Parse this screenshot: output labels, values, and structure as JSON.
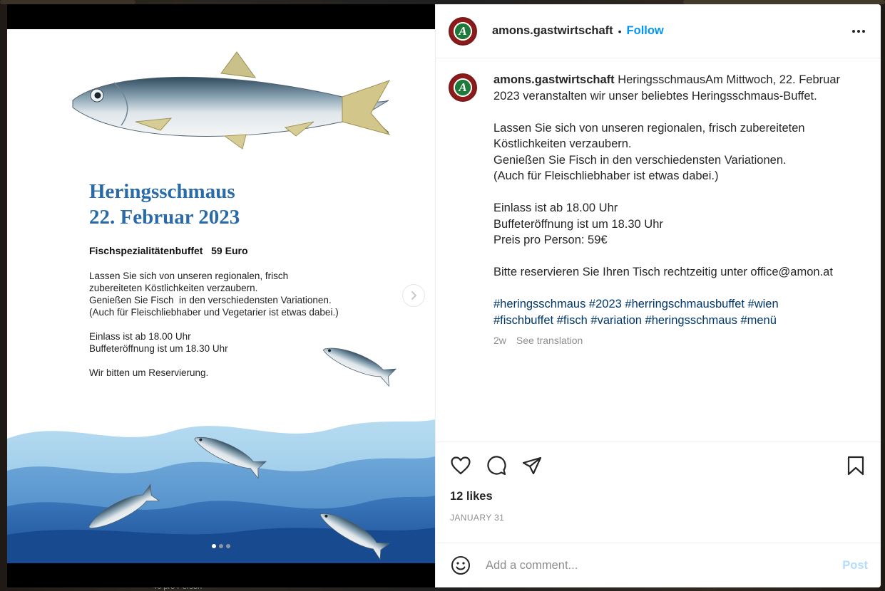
{
  "background": {
    "partial_text": "46 pro Person"
  },
  "post": {
    "username": "amons.gastwirtschaft",
    "separator": "•",
    "follow_label": "Follow",
    "avatar_letter": "A",
    "more_icon": "more-horizontal-icon"
  },
  "flyer": {
    "title_line1": "Heringsschmaus",
    "title_line2": "22. Februar 2023",
    "buffet_line": "Fischspezialitätenbuffet   59 Euro",
    "body": [
      "Lassen Sie sich von unseren regionalen, frisch",
      "zubereiteten Köstlichkeiten verzaubern.",
      "Genießen Sie Fisch  in den verschiedensten Variationen.",
      "(Auch für Fleischliebhaber und Vegetarier ist etwas dabei.)",
      "",
      "Einlass ist ab 18.00 Uhr",
      "Buffeteröffnung ist um 18.30 Uhr",
      "",
      "Wir bitten um Reservierung."
    ],
    "colors": {
      "title": "#2a6aa8",
      "wave_light": "#a9d2ec",
      "wave_dark": "#1f5fa6"
    }
  },
  "carousel": {
    "slide_count": 3,
    "active_index": 0,
    "next_icon": "chevron-right-icon"
  },
  "caption": {
    "username": "amons.gastwirtschaft",
    "lines": [
      "HeringsschmausAm Mittwoch, 22. Februar",
      "2023 veranstalten wir unser beliebtes Heringsschmaus-Buffet.",
      "",
      "Lassen Sie sich von unseren regionalen, frisch zubereiteten",
      "Köstlichkeiten verzaubern.",
      "Genießen Sie Fisch in den verschiedensten Variationen.",
      "(Auch für Fleischliebhaber ist etwas dabei.)",
      "",
      "Einlass ist ab 18.00 Uhr",
      "Buffeteröffnung ist um 18.30 Uhr",
      "Preis pro Person: 59€",
      "",
      "Bitte reservieren Sie Ihren Tisch rechtzeitig unter office@amon.at",
      ""
    ],
    "hashtags_line1": [
      "#heringsschmaus",
      "#2023",
      "#herringschmausbuffet",
      "#wien"
    ],
    "hashtags_line2": [
      "#fischbuffet",
      "#fisch",
      "#variation",
      "#heringsschmaus",
      "#menü"
    ],
    "age": "2w",
    "translate_label": "See translation"
  },
  "actions": {
    "icons": [
      "heart-icon",
      "comment-icon",
      "share-icon",
      "bookmark-icon"
    ],
    "likes": "12 likes",
    "date": "JANUARY 31"
  },
  "comment": {
    "placeholder": "Add a comment...",
    "post_label": "Post",
    "emoji_icon": "emoji-icon"
  },
  "colors": {
    "link_blue": "#0095f6",
    "hashtag": "#00376b",
    "muted": "#8e8e8e",
    "post_disabled": "#b3dbff"
  }
}
